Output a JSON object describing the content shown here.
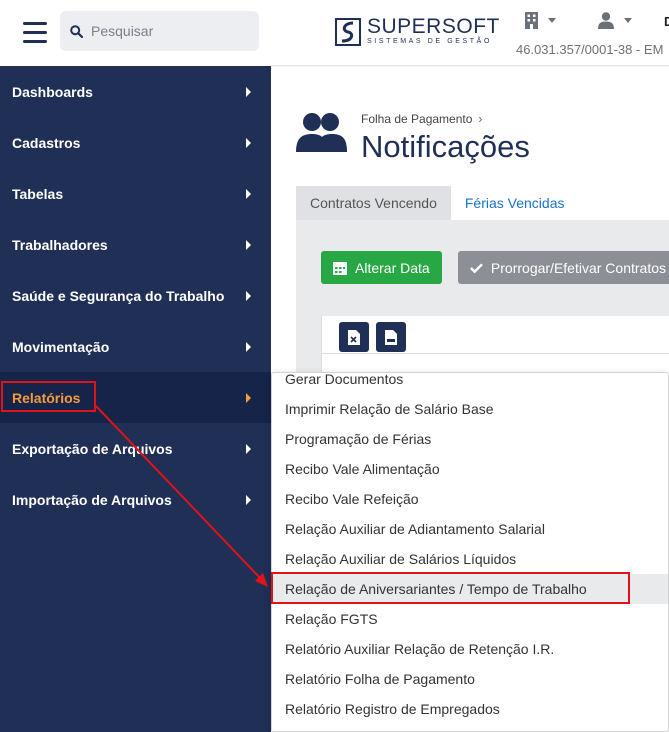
{
  "search": {
    "placeholder": "Pesquisar"
  },
  "sidebar": {
    "items": [
      {
        "label": "Dashboards"
      },
      {
        "label": "Cadastros"
      },
      {
        "label": "Tabelas"
      },
      {
        "label": "Trabalhadores"
      },
      {
        "label": "Saúde e Segurança do Trabalho"
      },
      {
        "label": "Movimentação"
      },
      {
        "label": "Relatórios"
      },
      {
        "label": "Exportação de Arquivos"
      },
      {
        "label": "Importação de Arquivos"
      }
    ]
  },
  "header": {
    "brand": "SUPERSOFT",
    "brand_sub": "SISTEMAS DE GESTÃO",
    "cnpj": "46.031.357/0001-38 - EM",
    "cut_letter": "D"
  },
  "page": {
    "breadcrumb": "Folha de Pagamento",
    "title": "Notificações",
    "tabs": [
      {
        "label": "Contratos Vencendo"
      },
      {
        "label": "Férias Vencidas"
      }
    ],
    "buttons": {
      "alter_date": "Alterar Data",
      "extend": "Prorrogar/Efetivar Contratos"
    }
  },
  "dropdown": {
    "items": [
      {
        "label": "Gerar Documentos"
      },
      {
        "label": "Imprimir Relação de Salário Base"
      },
      {
        "label": "Programação de Férias"
      },
      {
        "label": "Recibo Vale Alimentação"
      },
      {
        "label": "Recibo Vale Refeição"
      },
      {
        "label": "Relação Auxiliar de Adiantamento Salarial"
      },
      {
        "label": "Relação Auxiliar de Salários Líquidos"
      },
      {
        "label": "Relação de Aniversariantes / Tempo de Trabalho"
      },
      {
        "label": "Relação FGTS"
      },
      {
        "label": "Relatório Auxiliar Relação de Retenção I.R."
      },
      {
        "label": "Relatório Folha de Pagamento"
      },
      {
        "label": "Relatório Registro de Empregados"
      }
    ]
  },
  "colors": {
    "sidebar": "#1f2f56",
    "active_text": "#f39c3c",
    "annotation": "#e0121a",
    "green_button": "#28a745"
  }
}
